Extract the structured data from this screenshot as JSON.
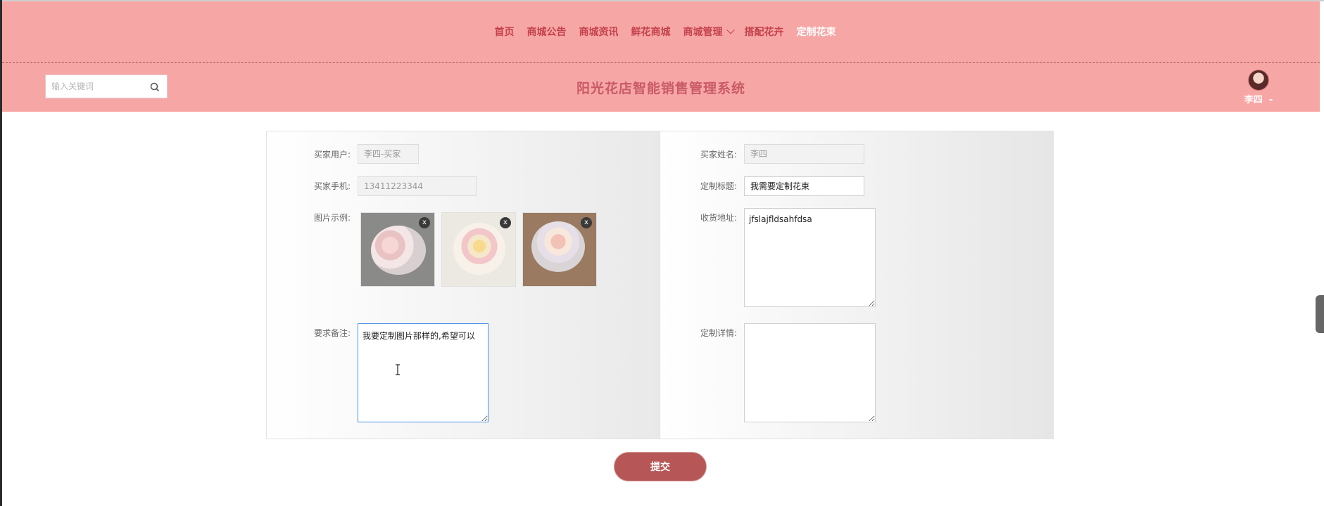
{
  "nav": {
    "items": [
      {
        "label": "首页"
      },
      {
        "label": "商城公告"
      },
      {
        "label": "商城资讯"
      },
      {
        "label": "鲜花商城"
      },
      {
        "label": "商城管理"
      },
      {
        "label": "搭配花卉"
      },
      {
        "label": "定制花束"
      }
    ],
    "active": "定制花束"
  },
  "header": {
    "search_placeholder": "输入关键词",
    "site_title": "阳光花店智能销售管理系统",
    "user_name": "李四"
  },
  "form": {
    "buyer_user_label": "买家用户:",
    "buyer_user_value": "李四-买家",
    "buyer_name_label": "买家姓名:",
    "buyer_name_value": "李四",
    "buyer_phone_label": "买家手机:",
    "buyer_phone_value": "13411223344",
    "custom_title_label": "定制标题:",
    "custom_title_value": "我需要定制花束",
    "images_label": "图片示例:",
    "address_label": "收货地址:",
    "address_value": "jfslajfldsahfdsa",
    "remarks_label": "要求备注:",
    "remarks_value": "我要定制图片那样的,希望可以",
    "details_label": "定制详情:",
    "details_value": "",
    "remove_glyph": "x",
    "submit_label": "提交"
  },
  "colors": {
    "header_bg": "#f7a6a6",
    "nav_text": "#c4414b",
    "title_text": "#c85a66",
    "submit_bg": "#b65656"
  }
}
